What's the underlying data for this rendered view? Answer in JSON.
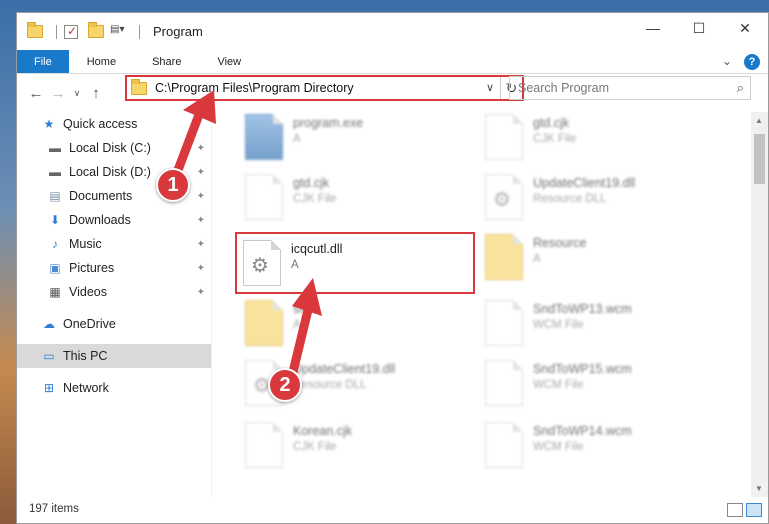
{
  "window": {
    "title": "Program",
    "controls": {
      "minimize": "—",
      "maximize": "☐",
      "close": "✕"
    }
  },
  "ribbon": {
    "tabs": [
      "File",
      "Home",
      "Share",
      "View"
    ],
    "help": "?"
  },
  "address": {
    "path": "C:\\Program Files\\Program Directory"
  },
  "search": {
    "placeholder": "Search Program"
  },
  "sidebar": {
    "quick_access": "Quick access",
    "items": [
      {
        "label": "Local Disk (C:)",
        "pinned": true
      },
      {
        "label": "Local Disk (D:)",
        "pinned": true
      },
      {
        "label": "Documents",
        "pinned": true
      },
      {
        "label": "Downloads",
        "pinned": true
      },
      {
        "label": "Music",
        "pinned": true
      },
      {
        "label": "Pictures",
        "pinned": true
      },
      {
        "label": "Videos",
        "pinned": true
      }
    ],
    "onedrive": "OneDrive",
    "thispc": "This PC",
    "network": "Network"
  },
  "files": [
    {
      "name": "program.exe",
      "type": "A"
    },
    {
      "name": "gtd.cjk",
      "type": "CJK File"
    },
    {
      "name": "gtd.cjk",
      "type": "CJK File"
    },
    {
      "name": "UpdateClient19.dll",
      "type": "Resource DLL"
    },
    {
      "name": "icqcutl.dll",
      "type": "A"
    },
    {
      "name": "Resource",
      "type": "A"
    },
    {
      "name": "sfd",
      "type": "A"
    },
    {
      "name": "SndToWP13.wcm",
      "type": "WCM File"
    },
    {
      "name": "UpdateClient19.dll",
      "type": "Resource DLL"
    },
    {
      "name": "SndToWP15.wcm",
      "type": "WCM File"
    },
    {
      "name": "Korean.cjk",
      "type": "CJK File"
    },
    {
      "name": "SndToWP14.wcm",
      "type": "WCM File"
    }
  ],
  "status": {
    "item_count": "197 items"
  },
  "annotations": {
    "badge1": "1",
    "badge2": "2",
    "color": "#d9383d"
  }
}
